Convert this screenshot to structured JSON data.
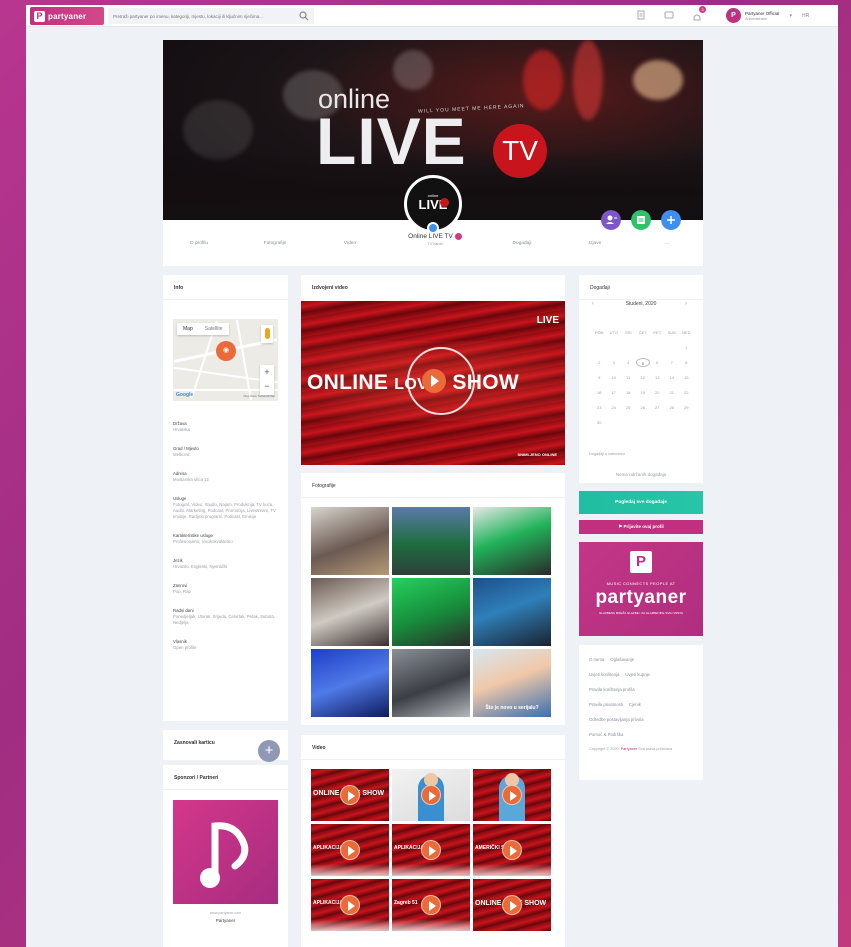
{
  "brand": {
    "name": "partyaner",
    "mark": "P"
  },
  "search": {
    "placeholder": "Pretraži partyaner po imenu, kategoriji, mjestu, lokaciji ili ključnim riječima..."
  },
  "topbar": {
    "notification_count": "3",
    "user_name": "Partyaner Official",
    "user_sub": "Administrator",
    "language": "HR"
  },
  "cover": {
    "online": "online",
    "live": "LIVE",
    "tv": "TV",
    "tagline": "WILL YOU MEET ME HERE AGAIN"
  },
  "avatar": {
    "small": "online",
    "main": "LIVE"
  },
  "profile_nav": {
    "items": [
      "O profilu",
      "Fotografije",
      "Video",
      "Događaji",
      "Izjave",
      "..."
    ],
    "title": "Online LIVE TV",
    "subtitle": "TV kanal"
  },
  "info": {
    "title": "Info",
    "map": {
      "tab_map": "Map",
      "tab_sat": "Satellite",
      "zoom_in": "+",
      "zoom_out": "−",
      "google": "Google",
      "footer": "Map Data   Terms of Use"
    },
    "rows": [
      {
        "label": "Država",
        "value": "Hrvatska"
      },
      {
        "label": "Grad / Mjesto",
        "value": "Metković"
      },
      {
        "label": "Adresa",
        "value": "Mostarska ulica 12"
      },
      {
        "label": "Usluge",
        "value": "Fotograf, Video, Studio, Najam, Produkcija, TV kuća, Audio, Marketing, Podcast, Promocija, Livestream, TV emisije, Radijski programi, Podcast, Emisije"
      },
      {
        "label": "Karakteristike usluge",
        "value": "Profesionalno, Visokokvalitetno"
      },
      {
        "label": "Jezik",
        "value": "Hrvatski, Engleski, Njemački"
      },
      {
        "label": "Zanrovi",
        "value": "Pop, Rap"
      },
      {
        "label": "Radni dani",
        "value": "Ponedjeljak, Utorak, Srijeda, Četvrtak, Petak, Subota, Nedjelja"
      },
      {
        "label": "Vlasnik",
        "value": "Open profile"
      }
    ]
  },
  "recommend": {
    "title": "Zasnovali karticu"
  },
  "sponsors": {
    "title": "Sponzori / Partneri",
    "url": "www.partyaner.com",
    "name": "Partyaner"
  },
  "featured": {
    "title": "Izdvojeni video",
    "headline_left": "ONLINE",
    "headline_mid": "LOVE",
    "headline_right": "SHOW",
    "logo": "LIVE",
    "footer": "SNIMLJENO ONLINE"
  },
  "photos": {
    "title": "Fotografije",
    "caption": "Što je novo u serijalu?"
  },
  "videos": {
    "title": "Video",
    "labels": [
      "ONLINE LOVE SHOW",
      "",
      "",
      "APLIKACIJA LAZIĆ",
      "APLIKACIJA LAZIĆ",
      "AMERIČKI STIL",
      "APLIKACIJA LAZIĆ",
      "Zagreb 51",
      "ONLINE LOVE SHOW"
    ]
  },
  "calendar": {
    "title": "Događaji",
    "month": "Studeni, 2020",
    "days": [
      "PON",
      "UTO",
      "SRI",
      "ČET",
      "PET",
      "SUB",
      "NED"
    ],
    "cells": [
      "",
      "",
      "",
      "",
      "",
      "",
      "1",
      "2",
      "3",
      "4",
      "5",
      "6",
      "7",
      "8",
      "9",
      "10",
      "11",
      "12",
      "13",
      "14",
      "15",
      "16",
      "17",
      "18",
      "19",
      "20",
      "21",
      "22",
      "23",
      "24",
      "25",
      "26",
      "27",
      "28",
      "29",
      "30"
    ],
    "today": "5",
    "link": "Događaji u kalendaru",
    "empty": "Nema održanih događaja"
  },
  "buttons": {
    "add_event": "Pogledaj sve događaje",
    "report": "Prijavite ovaj profil"
  },
  "promo": {
    "mark": "P",
    "tag": "MUSIC CONNECTS PEOPLE AT",
    "name": "partyaner",
    "sub": "GLAZBENA MREŽA GLAZBE I ZA GLAZBENIKE SVIH VRSTA"
  },
  "footer": {
    "rows": [
      [
        "O nama",
        "Oglašavanje"
      ],
      [
        "Uvjeti korištenja",
        "Uvjeti kupnje"
      ],
      [
        "Pravila korištenja profila"
      ],
      [
        "Pravila privatnosti",
        "Cjenik"
      ],
      [
        "Odredbe postavljanja privola"
      ],
      [
        "Pomoć & Podrška"
      ]
    ],
    "copyright_pre": "Copyright © 2020.",
    "copyright_brand": "Partyaner",
    "copyright_post": "Sva prava pridržana"
  },
  "colors": {
    "brand": "#c0307e",
    "teal": "#22bda1",
    "accent": "#ea6a3a",
    "verified": "#3d8ff0"
  }
}
